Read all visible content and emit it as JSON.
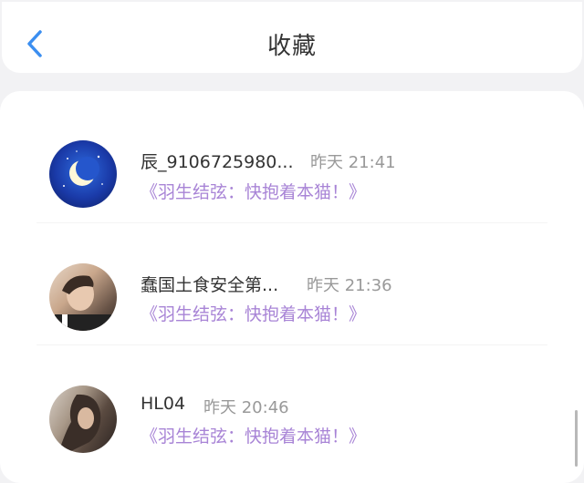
{
  "header": {
    "title": "收藏",
    "back_icon": "chevron-left-icon",
    "accent": "#3b8ef0"
  },
  "favorites": [
    {
      "name": "辰_9106725980...",
      "time": "昨天 21:41",
      "work": "《羽生结弦：快抱着本猫！》"
    },
    {
      "name": "蠢国土食安全第...",
      "time": "昨天 21:36",
      "work": "《羽生结弦：快抱着本猫！》"
    },
    {
      "name": "HL04",
      "time": "昨天 20:46",
      "work": "《羽生结弦：快抱着本猫！》"
    }
  ],
  "colors": {
    "work_link": "#a884d6",
    "time": "#999999"
  }
}
